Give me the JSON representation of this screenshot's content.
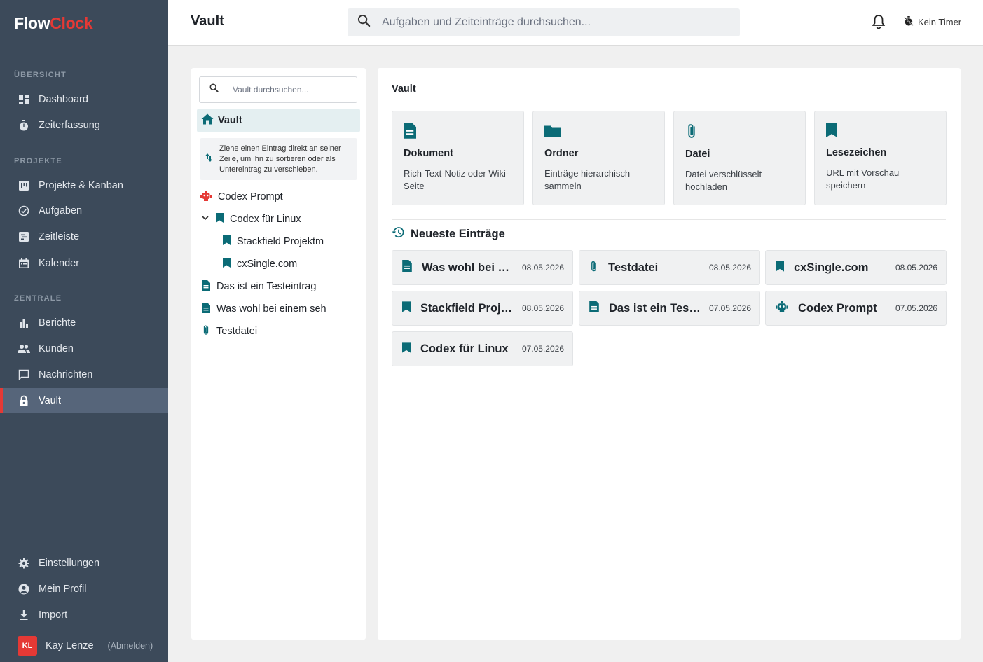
{
  "app": {
    "logo_part1": "Flow",
    "logo_part2": "Clock",
    "accent": "#e53935",
    "brand_teal": "#0b6b76"
  },
  "sidebar": {
    "sections": [
      {
        "label": "ÜBERSICHT"
      },
      {
        "label": "PROJEKTE"
      },
      {
        "label": "ZENTRALE"
      }
    ],
    "items": [
      {
        "label": "Dashboard",
        "icon": "dashboard-icon"
      },
      {
        "label": "Zeiterfassung",
        "icon": "stopwatch-icon"
      },
      {
        "label": "Projekte & Kanban",
        "icon": "kanban-icon"
      },
      {
        "label": "Aufgaben",
        "icon": "check-circle-icon"
      },
      {
        "label": "Zeitleiste",
        "icon": "timeline-icon"
      },
      {
        "label": "Kalender",
        "icon": "calendar-icon"
      },
      {
        "label": "Berichte",
        "icon": "bar-chart-icon"
      },
      {
        "label": "Kunden",
        "icon": "people-icon"
      },
      {
        "label": "Nachrichten",
        "icon": "chat-icon"
      },
      {
        "label": "Vault",
        "icon": "lock-icon",
        "active": true
      },
      {
        "label": "Einstellungen",
        "icon": "gear-icon"
      },
      {
        "label": "Mein Profil",
        "icon": "account-icon"
      },
      {
        "label": "Import",
        "icon": "download-icon"
      }
    ],
    "user": {
      "initials": "KL",
      "name": "Kay Lenze",
      "logout": "(Abmelden)"
    }
  },
  "header": {
    "title": "Vault",
    "search_placeholder": "Aufgaben und Zeiteinträge durchsuchen...",
    "timer_label": "Kein Timer"
  },
  "tree": {
    "search_placeholder": "Vault durchsuchen...",
    "root_label": "Vault",
    "hint": "Ziehe einen Eintrag direkt an seiner Zeile, um ihn zu sortieren oder als Untereintrag zu verschieben.",
    "items": [
      {
        "label": "Codex Prompt",
        "icon": "robot-icon"
      },
      {
        "label": "Codex für Linux",
        "icon": "bookmark-icon"
      },
      {
        "label": "Stackfield Projektm",
        "icon": "bookmark-icon"
      },
      {
        "label": "cxSingle.com",
        "icon": "bookmark-icon"
      },
      {
        "label": "Das ist ein Testeintrag",
        "icon": "document-icon"
      },
      {
        "label": "Was wohl bei einem seh",
        "icon": "document-icon"
      },
      {
        "label": "Testdatei",
        "icon": "paperclip-icon"
      }
    ]
  },
  "main": {
    "title": "Vault",
    "types": [
      {
        "title": "Dokument",
        "desc": "Rich-Text-Notiz oder Wiki-Seite",
        "icon": "document-icon"
      },
      {
        "title": "Ordner",
        "desc": "Einträge hierarchisch sammeln",
        "icon": "folder-icon"
      },
      {
        "title": "Datei",
        "desc": "Datei verschlüsselt hochladen",
        "icon": "paperclip-icon"
      },
      {
        "title": "Lesezeichen",
        "desc": "URL mit Vorschau speichern",
        "icon": "bookmark-icon"
      }
    ],
    "recent_title": "Neueste Einträge",
    "recent": [
      {
        "name": "Was wohl bei einem sehr langen Titel",
        "date": "08.05.2026",
        "icon": "document-icon"
      },
      {
        "name": "Testdatei",
        "date": "08.05.2026",
        "icon": "paperclip-icon"
      },
      {
        "name": "cxSingle.com",
        "date": "08.05.2026",
        "icon": "bookmark-icon"
      },
      {
        "name": "Stackfield Projektmanagement",
        "date": "08.05.2026",
        "icon": "bookmark-icon"
      },
      {
        "name": "Das ist ein Testeintrag",
        "date": "07.05.2026",
        "icon": "document-icon"
      },
      {
        "name": "Codex Prompt",
        "date": "07.05.2026",
        "icon": "robot-icon"
      },
      {
        "name": "Codex für Linux",
        "date": "07.05.2026",
        "icon": "bookmark-icon"
      }
    ]
  }
}
